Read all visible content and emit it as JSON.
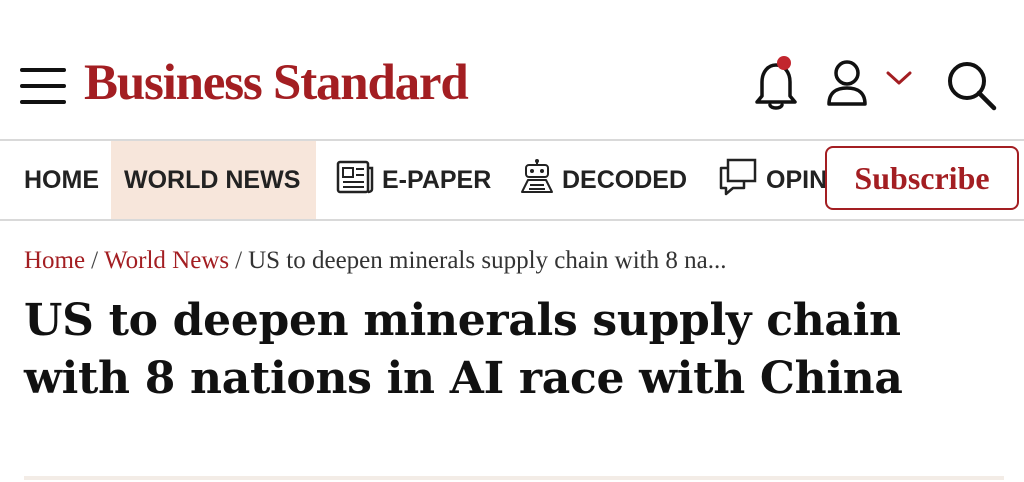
{
  "header": {
    "logo_text": "Business Standard",
    "brand_color": "#a31e22",
    "icons": [
      "menu-icon",
      "bell-icon",
      "user-icon",
      "chevron-down-icon",
      "search-icon"
    ],
    "notification_dot": true
  },
  "nav": {
    "items": [
      {
        "label": "HOME",
        "active": false
      },
      {
        "label": "WORLD NEWS",
        "active": true
      },
      {
        "label": "E-PAPER",
        "icon": "newspaper-icon"
      },
      {
        "label": "DECODED",
        "icon": "robot-icon"
      },
      {
        "label": "OPINION",
        "icon": "chat-bubble-icon"
      }
    ],
    "active_bg": "#f7e6db",
    "subscribe_label": "Subscribe"
  },
  "breadcrumb": {
    "items": [
      "Home",
      "World News",
      "US to deepen minerals supply chain with 8 na..."
    ],
    "separator": "/"
  },
  "article": {
    "headline": "US to deepen minerals supply chain with 8 nations in AI race with China"
  }
}
